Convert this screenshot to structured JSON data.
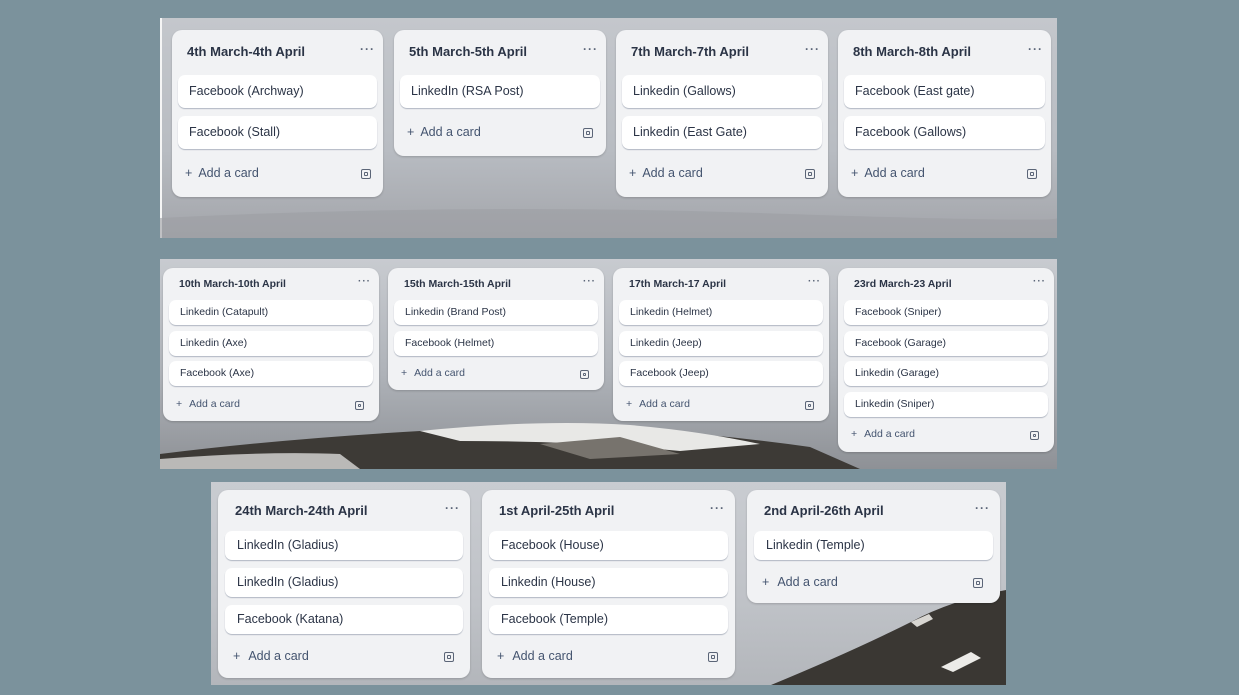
{
  "colors": {
    "page_bg": "#7b929c",
    "list_bg": "#f1f2f4",
    "card_bg": "#ffffff",
    "text": "#2b3446"
  },
  "icons": {
    "more": "ellipsis-icon",
    "add": "plus-icon",
    "template": "card-template-icon"
  },
  "boards": [
    {
      "lists": [
        {
          "title": "4th March-4th April",
          "more": "···",
          "cards": [
            "Facebook (Archway)",
            "Facebook (Stall)"
          ],
          "add_label": "Add a card"
        },
        {
          "title": "5th March-5th April",
          "more": "···",
          "cards": [
            "LinkedIn (RSA Post)"
          ],
          "add_label": "Add a card"
        },
        {
          "title": "7th March-7th April",
          "more": "···",
          "cards": [
            "Linkedin (Gallows)",
            "Linkedin (East Gate)"
          ],
          "add_label": "Add a card"
        },
        {
          "title": "8th March-8th April",
          "more": "···",
          "cards": [
            "Facebook (East gate)",
            "Facebook (Gallows)"
          ],
          "add_label": "Add a card"
        }
      ]
    },
    {
      "lists": [
        {
          "title": "10th March-10th April",
          "more": "···",
          "cards": [
            "Linkedin (Catapult)",
            "Linkedin (Axe)",
            "Facebook (Axe)"
          ],
          "add_label": "Add a card"
        },
        {
          "title": "15th March-15th April",
          "more": "···",
          "cards": [
            "Linkedin (Brand Post)",
            "Facebook (Helmet)"
          ],
          "add_label": "Add a card"
        },
        {
          "title": "17th March-17 April",
          "more": "···",
          "cards": [
            "Linkedin (Helmet)",
            "Linkedin (Jeep)",
            "Facebook (Jeep)"
          ],
          "add_label": "Add a card"
        },
        {
          "title": "23rd March-23 April",
          "more": "···",
          "cards": [
            "Facebook (Sniper)",
            "Facebook (Garage)",
            "Linkedin (Garage)",
            "Linkedin (Sniper)"
          ],
          "add_label": "Add a card"
        }
      ]
    },
    {
      "lists": [
        {
          "title": "24th March-24th April",
          "more": "···",
          "cards": [
            "LinkedIn (Gladius)",
            "LinkedIn (Gladius)",
            "Facebook (Katana)"
          ],
          "add_label": "Add a card"
        },
        {
          "title": "1st April-25th April",
          "more": "···",
          "cards": [
            "Facebook (House)",
            "Linkedin (House)",
            "Facebook (Temple)"
          ],
          "add_label": "Add a card"
        },
        {
          "title": "2nd April-26th April",
          "more": "···",
          "cards": [
            "Linkedin (Temple)"
          ],
          "add_label": "Add a card"
        }
      ]
    }
  ]
}
